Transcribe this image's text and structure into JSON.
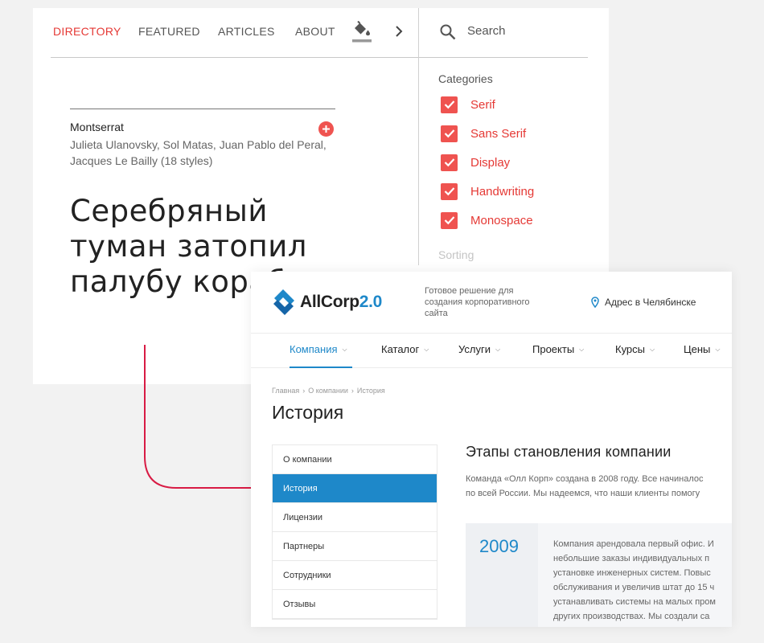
{
  "gf": {
    "nav": {
      "directory": "DIRECTORY",
      "featured": "FEATURED",
      "articles": "ARTICLES",
      "about": "ABOUT"
    },
    "search": {
      "placeholder": "Search"
    },
    "categories": {
      "title": "Categories",
      "items": [
        "Serif",
        "Sans Serif",
        "Display",
        "Handwriting",
        "Monospace"
      ]
    },
    "sorting_label": "Sorting",
    "specimen": {
      "font_name": "Montserrat",
      "designers": "Julieta Ulanovsky, Sol Matas, Juan Pablo del Peral, Jacques Le Bailly (18 styles)",
      "sample_text": "Серебряный туман затопил палубу корабля."
    },
    "colors": {
      "accent": "#e53935"
    }
  },
  "ac": {
    "logo": {
      "name": "AllCorp",
      "version": "2.0"
    },
    "tagline": "Готовое решение для создания корпоративного сайта",
    "address": "Адрес в Челябинске",
    "nav": [
      "Компания",
      "Каталог",
      "Услуги",
      "Проекты",
      "Курсы",
      "Цены"
    ],
    "breadcrumb": [
      "Главная",
      "О компании",
      "История"
    ],
    "title": "История",
    "sidebar": [
      "О компании",
      "История",
      "Лицензии",
      "Партнеры",
      "Сотрудники",
      "Отзывы"
    ],
    "section_title": "Этапы становления компании",
    "intro": [
      "Команда «Олл Корп» создана в 2008 году. Все начиналос",
      "по всей России. Мы надеемся, что наши клиенты помогу"
    ],
    "timeline": {
      "year": "2009",
      "lines": [
        "Компания арендовала первый офис. И",
        "небольшие заказы индивидуальных п",
        "установке инженерных систем. Повыс",
        "обслуживания и увеличив штат до 15 ч",
        "устанавливать системы на малых пром",
        "других производствах. Мы создали са"
      ]
    },
    "colors": {
      "brand": "#1e88c9"
    }
  }
}
